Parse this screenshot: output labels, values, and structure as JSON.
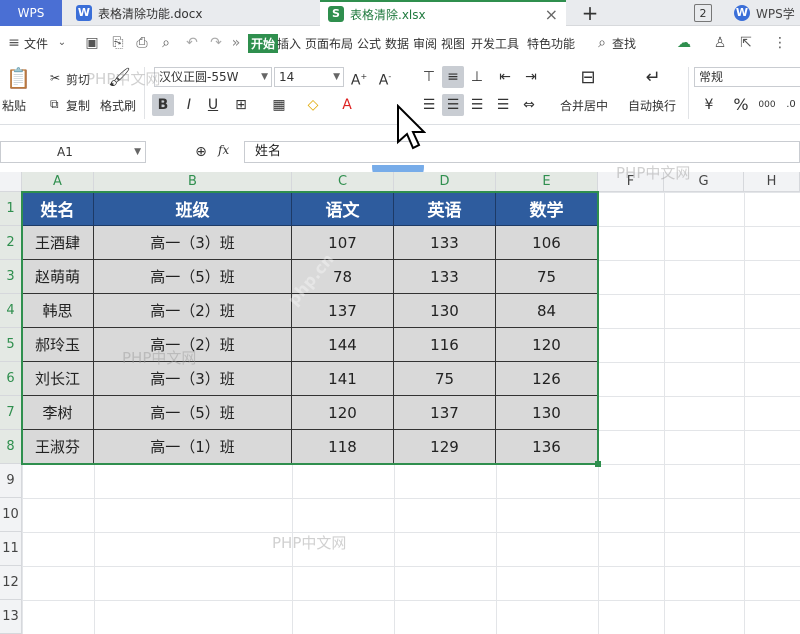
{
  "titlebar": {
    "app_tab": "WPS",
    "doc_tab": "表格清除功能.docx",
    "xls_tab": "表格清除.xlsx",
    "tab_count": "2",
    "account": "WPS学",
    "new_tab": "+"
  },
  "menubar": {
    "file": "文件",
    "tabs": [
      "开始",
      "插入",
      "页面布局",
      "公式",
      "数据",
      "审阅",
      "视图",
      "开发工具",
      "特色功能"
    ],
    "active_tab": "开始",
    "search": "查找"
  },
  "ribbon": {
    "paste": "粘贴",
    "cut": "剪切",
    "copy": "复制",
    "format_painter": "格式刷",
    "font_name": "汉仪正圆-55W",
    "font_size": "14",
    "merge_center": "合并居中",
    "wrap_text": "自动换行",
    "number_format": "常规",
    "percent": "%"
  },
  "formula": {
    "name_box": "A1",
    "fx_label": "fx",
    "value": "姓名"
  },
  "grid": {
    "columns": [
      "A",
      "B",
      "C",
      "D",
      "E",
      "F",
      "G",
      "H"
    ],
    "rows": [
      "1",
      "2",
      "3",
      "4",
      "5",
      "6",
      "7",
      "8",
      "9",
      "10",
      "11",
      "12",
      "13"
    ],
    "headers": [
      "姓名",
      "班级",
      "语文",
      "英语",
      "数学"
    ],
    "data": [
      [
        "王酒肆",
        "高一（3）班",
        "107",
        "133",
        "106"
      ],
      [
        "赵萌萌",
        "高一（5）班",
        "78",
        "133",
        "75"
      ],
      [
        "韩思",
        "高一（2）班",
        "137",
        "130",
        "84"
      ],
      [
        "郝玲玉",
        "高一（2）班",
        "144",
        "116",
        "120"
      ],
      [
        "刘长江",
        "高一（3）班",
        "141",
        "75",
        "126"
      ],
      [
        "李树",
        "高一（5）班",
        "120",
        "137",
        "130"
      ],
      [
        "王淑芬",
        "高一（1）班",
        "118",
        "129",
        "136"
      ]
    ]
  },
  "watermarks": [
    "PHP中文网",
    "PHP中文网",
    "PHP中文网",
    "PHP中文网",
    "php.cn"
  ],
  "colors": {
    "header_fill": "#2e5c9e",
    "data_fill": "#d9d9d9",
    "selection": "#2f8f4e",
    "active_tab": "#2f8f4e"
  }
}
